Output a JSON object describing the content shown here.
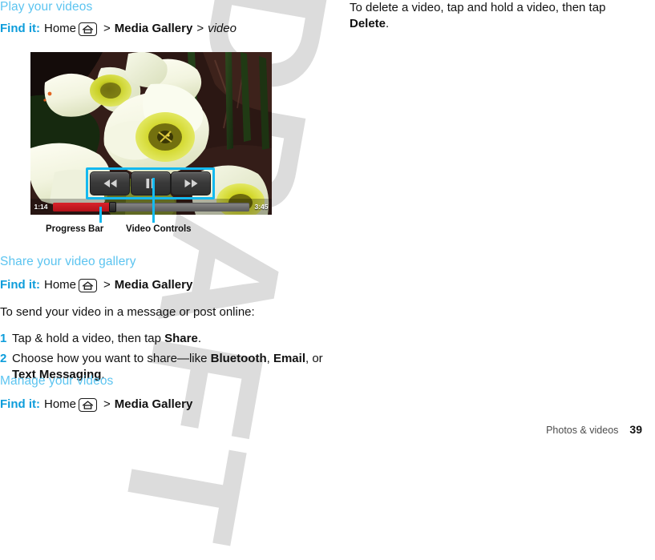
{
  "document": {
    "watermark": "DRAFT",
    "footer": {
      "chapter": "Photos & videos",
      "page_number": "39"
    }
  },
  "colors": {
    "heading_blue": "#5cc4f0",
    "find_it_blue": "#0d9ddb",
    "callout_cyan": "#14b9ef",
    "progress_red": "#d9232a",
    "body_text": "#111111"
  },
  "left_column": {
    "section1": {
      "heading": "Play your videos",
      "find_it": {
        "lead": "Find it:",
        "home": "Home",
        "home_icon": "home-icon",
        "sep1": ">",
        "target1": "Media Gallery",
        "sep2": ">",
        "target2": "video"
      }
    },
    "figure": {
      "image_alt": "daffodil-flowers-video-frame",
      "video_player": {
        "elapsed_time": "1:14",
        "total_time": "3:45",
        "progress_percent": 30,
        "buttons": [
          {
            "name": "rewind-button",
            "icon": "rewind-icon"
          },
          {
            "name": "pause-button",
            "icon": "pause-icon"
          },
          {
            "name": "fast-forward-button",
            "icon": "fast-forward-icon"
          }
        ]
      },
      "callouts": [
        {
          "label": "Progress Bar"
        },
        {
          "label": "Video Controls"
        }
      ]
    },
    "section2": {
      "heading": "Share your video gallery",
      "find_it": {
        "lead": "Find it:",
        "home": "Home",
        "home_icon": "home-icon",
        "sep1": ">",
        "target1": "Media Gallery"
      },
      "intro": "To send your video in a message or post online:",
      "steps": [
        {
          "num": "1",
          "parts": [
            {
              "t": "Tap & hold a video, then tap ",
              "b": false
            },
            {
              "t": "Share",
              "b": true
            },
            {
              "t": ".",
              "b": false
            }
          ]
        },
        {
          "num": "2",
          "parts": [
            {
              "t": "Choose how you want to share—like ",
              "b": false
            },
            {
              "t": "Bluetooth",
              "b": true
            },
            {
              "t": ", ",
              "b": false
            },
            {
              "t": "Email",
              "b": true
            },
            {
              "t": ", or ",
              "b": false
            },
            {
              "t": "Text Messaging",
              "b": true
            },
            {
              "t": ".",
              "b": false
            }
          ]
        }
      ]
    },
    "section3": {
      "heading": "Manage your videos",
      "find_it": {
        "lead": "Find it:",
        "home": "Home",
        "home_icon": "home-icon",
        "sep1": ">",
        "target1": "Media Gallery"
      }
    }
  },
  "right_column": {
    "paragraph": {
      "parts": [
        {
          "t": "To delete a video, tap and hold a video, then tap ",
          "b": false
        },
        {
          "t": "Delete",
          "b": true
        },
        {
          "t": ".",
          "b": false
        }
      ]
    }
  }
}
